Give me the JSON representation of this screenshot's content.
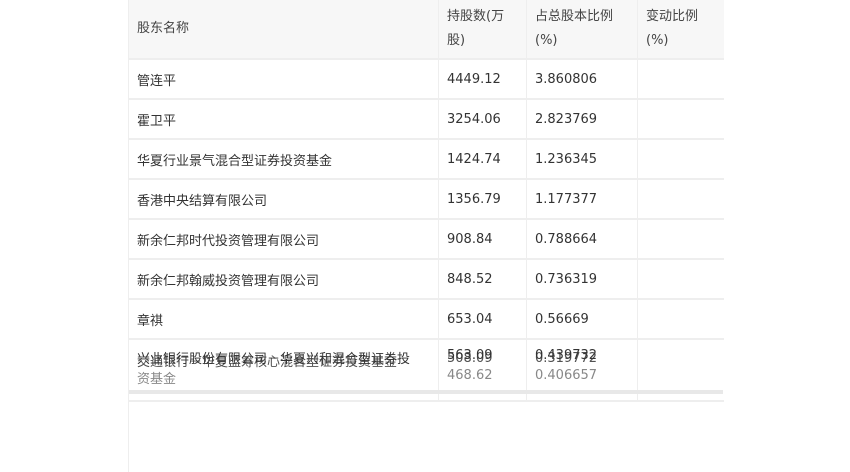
{
  "table": {
    "headers": [
      "股东名称",
      "持股数(万股)",
      "占总股本比例(%)",
      "变动比例(%)"
    ],
    "rows": [
      {
        "name": "管连平",
        "shares": "4449.12",
        "ratio": "3.860806",
        "change": ""
      },
      {
        "name": "霍卫平",
        "shares": "3254.06",
        "ratio": "2.823769",
        "change": ""
      },
      {
        "name": "华夏行业景气混合型证券投资基金",
        "shares": "1424.74",
        "ratio": "1.236345",
        "change": ""
      },
      {
        "name": "香港中央结算有限公司",
        "shares": "1356.79",
        "ratio": "1.177377",
        "change": ""
      },
      {
        "name": "新余仁邦时代投资管理有限公司",
        "shares": "908.84",
        "ratio": "0.788664",
        "change": ""
      },
      {
        "name": "新余仁邦翰威投资管理有限公司",
        "shares": "848.52",
        "ratio": "0.736319",
        "change": ""
      },
      {
        "name": "章祺",
        "shares": "653.04",
        "ratio": "0.56669",
        "change": ""
      }
    ],
    "overlap_row": {
      "name_a": "兴业银行股份有限公司－华夏兴和混合型证券投",
      "name_b": "交通银行－华夏蓝筹核心混合型证券投资基金",
      "name_c": "资基金",
      "shares_a": "563.09",
      "shares_b": "508.09",
      "shares_c": "468.62",
      "ratio_a": "0.439732",
      "ratio_b": "0.319772",
      "ratio_c": "0.406657"
    }
  }
}
